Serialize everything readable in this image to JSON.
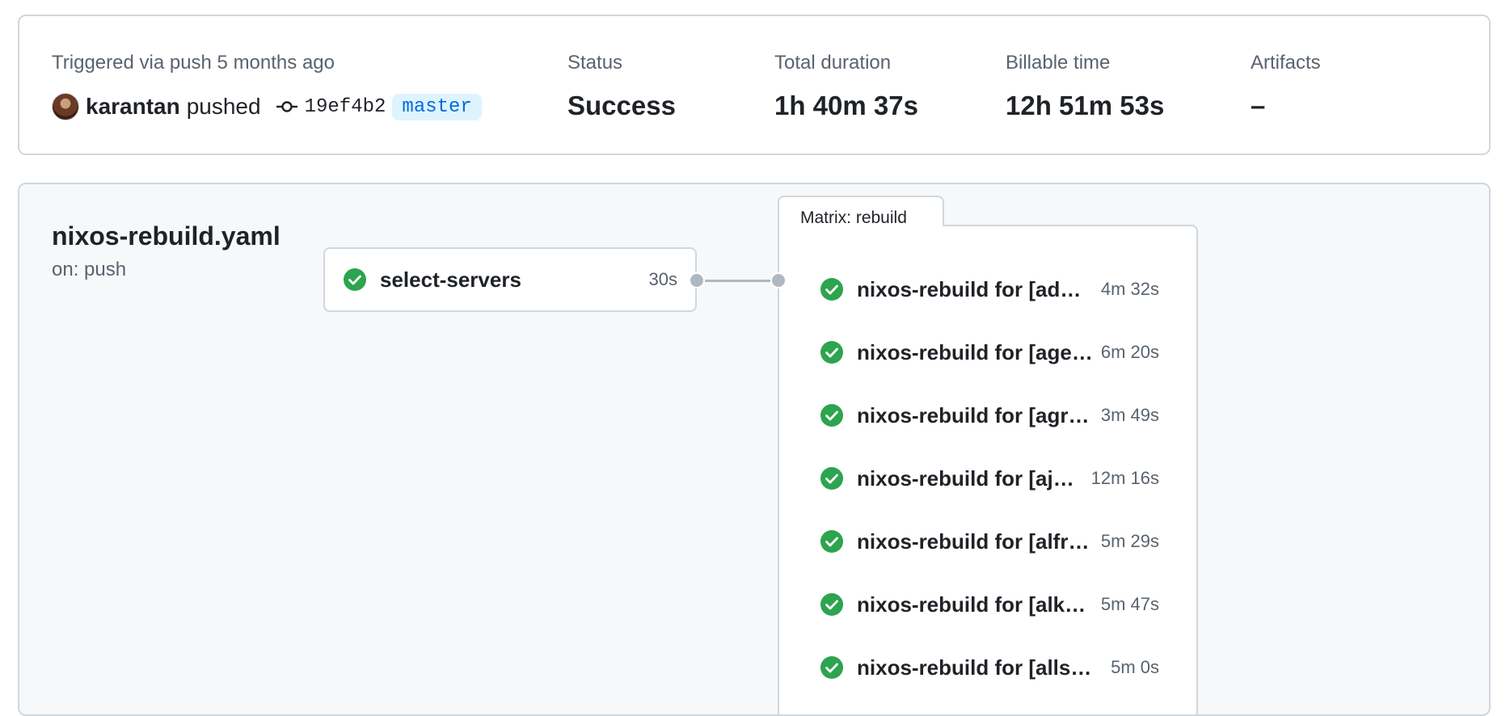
{
  "summary": {
    "trigger_label": "Triggered via push 5 months ago",
    "actor": "karantan",
    "action": "pushed",
    "commit_sha": "19ef4b2",
    "branch": "master",
    "status_label": "Status",
    "status_value": "Success",
    "duration_label": "Total duration",
    "duration_value": "1h 40m 37s",
    "billable_label": "Billable time",
    "billable_value": "12h 51m 53s",
    "artifacts_label": "Artifacts",
    "artifacts_value": "–"
  },
  "workflow": {
    "file": "nixos-rebuild.yaml",
    "trigger": "on: push",
    "first_job": {
      "name": "select-servers",
      "duration": "30s"
    },
    "matrix": {
      "tab_label": "Matrix: rebuild",
      "jobs": [
        {
          "name": "nixos-rebuild for [addi...",
          "duration": "4m 32s"
        },
        {
          "name": "nixos-rebuild for [agen...",
          "duration": "6m 20s"
        },
        {
          "name": "nixos-rebuild for [agree]",
          "duration": "3m 49s"
        },
        {
          "name": "nixos-rebuild for [ajw...",
          "duration": "12m 16s"
        },
        {
          "name": "nixos-rebuild for [alfred]",
          "duration": "5m 29s"
        },
        {
          "name": "nixos-rebuild for [alka...",
          "duration": "5m 47s"
        },
        {
          "name": "nixos-rebuild for [allspi...",
          "duration": "5m 0s"
        }
      ]
    }
  },
  "colors": {
    "success": "#2da44e",
    "branch_text": "#0969da",
    "branch_bg": "#ddf4ff",
    "border": "#d0d7de",
    "muted": "#59636e"
  },
  "icons": {
    "status": "check-circle-icon",
    "commit": "git-commit-icon"
  }
}
